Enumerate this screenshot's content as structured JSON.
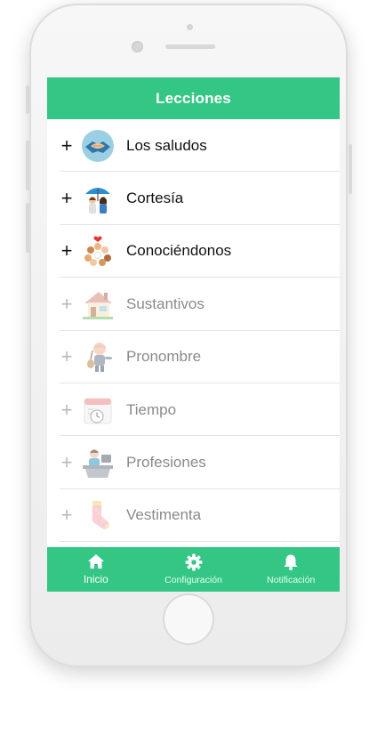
{
  "header": {
    "title": "Lecciones"
  },
  "lessons": [
    {
      "label": "Los saludos",
      "icon": "handshake-icon",
      "locked": false
    },
    {
      "label": "Cortesía",
      "icon": "umbrella-couple-icon",
      "locked": false
    },
    {
      "label": "Conociéndonos",
      "icon": "people-circle-icon",
      "locked": false
    },
    {
      "label": "Sustantivos",
      "icon": "house-icon",
      "locked": true
    },
    {
      "label": "Pronombre",
      "icon": "boy-guitar-icon",
      "locked": true
    },
    {
      "label": "Tiempo",
      "icon": "calendar-clock-icon",
      "locked": true
    },
    {
      "label": "Profesiones",
      "icon": "office-worker-icon",
      "locked": true
    },
    {
      "label": "Vestimenta",
      "icon": "sock-icon",
      "locked": true
    }
  ],
  "plus_symbol": "+",
  "tabs": [
    {
      "label": "Inicio",
      "icon": "home-icon",
      "active": true
    },
    {
      "label": "Configuración",
      "icon": "gear-icon",
      "active": false
    },
    {
      "label": "Notificación",
      "icon": "bell-icon",
      "active": false
    }
  ],
  "colors": {
    "accent": "#34c684",
    "locked_text": "#8a8a8a"
  }
}
